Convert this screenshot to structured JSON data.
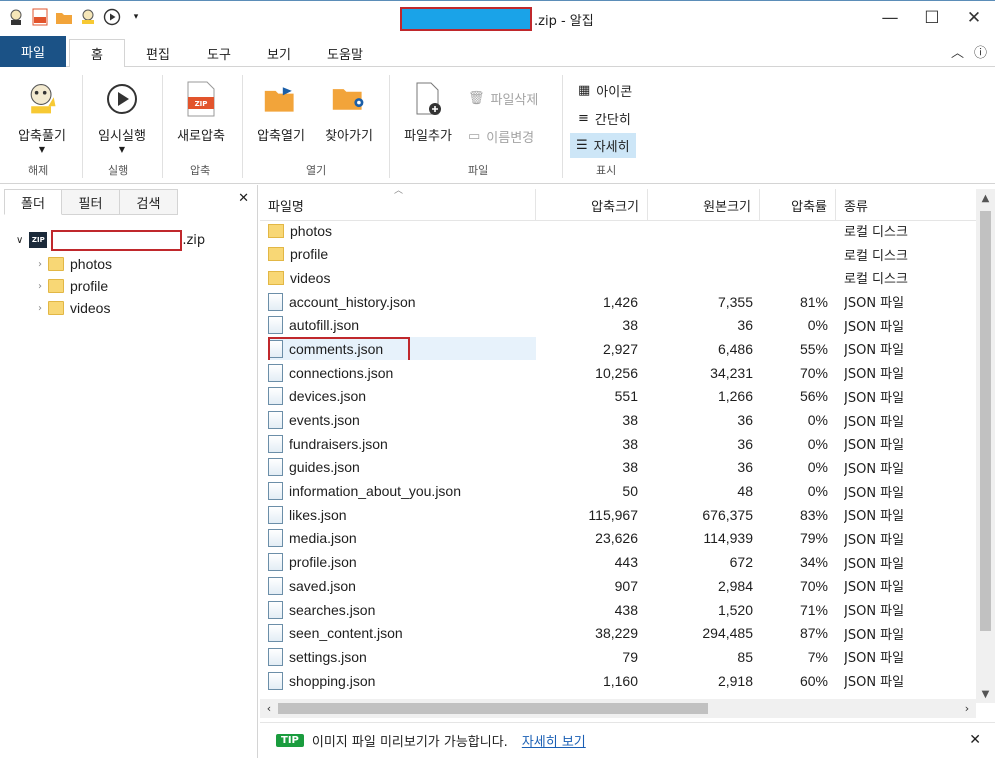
{
  "window": {
    "title_suffix": ".zip - 알집",
    "controls": {
      "minimize": "—",
      "maximize": "☐",
      "close": "✕"
    }
  },
  "tabs": [
    "파일",
    "홈",
    "편집",
    "도구",
    "보기",
    "도움말"
  ],
  "ribbon": {
    "extract": {
      "label": "압축풀기",
      "group": "해제"
    },
    "run": {
      "label": "임시실행",
      "group": "실행"
    },
    "new_zip": {
      "label": "새로압축",
      "group": "압축"
    },
    "open_zip": {
      "label": "압축열기"
    },
    "find": {
      "label": "찾아가기"
    },
    "open_group": "열기",
    "add_file": {
      "label": "파일추가"
    },
    "delete_file": {
      "label": "파일삭제"
    },
    "rename": {
      "label": "이름변경"
    },
    "file_group": "파일",
    "view_icons": "아이콘",
    "view_simple": "간단히",
    "view_detail": "자세히",
    "view_group": "표시"
  },
  "left_pane": {
    "tabs": [
      "폴더",
      "필터",
      "검색"
    ],
    "root_suffix": ".zip",
    "folders": [
      "photos",
      "profile",
      "videos"
    ]
  },
  "columns": [
    "파일명",
    "압축크기",
    "원본크기",
    "압축률",
    "종류"
  ],
  "files": [
    {
      "name": "photos",
      "c": "",
      "o": "",
      "r": "",
      "t": "로컬 디스크",
      "folder": true
    },
    {
      "name": "profile",
      "c": "",
      "o": "",
      "r": "",
      "t": "로컬 디스크",
      "folder": true
    },
    {
      "name": "videos",
      "c": "",
      "o": "",
      "r": "",
      "t": "로컬 디스크",
      "folder": true
    },
    {
      "name": "account_history.json",
      "c": "1,426",
      "o": "7,355",
      "r": "81%",
      "t": "JSON 파일"
    },
    {
      "name": "autofill.json",
      "c": "38",
      "o": "36",
      "r": "0%",
      "t": "JSON 파일"
    },
    {
      "name": "comments.json",
      "c": "2,927",
      "o": "6,486",
      "r": "55%",
      "t": "JSON 파일",
      "selected": true
    },
    {
      "name": "connections.json",
      "c": "10,256",
      "o": "34,231",
      "r": "70%",
      "t": "JSON 파일"
    },
    {
      "name": "devices.json",
      "c": "551",
      "o": "1,266",
      "r": "56%",
      "t": "JSON 파일"
    },
    {
      "name": "events.json",
      "c": "38",
      "o": "36",
      "r": "0%",
      "t": "JSON 파일"
    },
    {
      "name": "fundraisers.json",
      "c": "38",
      "o": "36",
      "r": "0%",
      "t": "JSON 파일"
    },
    {
      "name": "guides.json",
      "c": "38",
      "o": "36",
      "r": "0%",
      "t": "JSON 파일"
    },
    {
      "name": "information_about_you.json",
      "c": "50",
      "o": "48",
      "r": "0%",
      "t": "JSON 파일"
    },
    {
      "name": "likes.json",
      "c": "115,967",
      "o": "676,375",
      "r": "83%",
      "t": "JSON 파일"
    },
    {
      "name": "media.json",
      "c": "23,626",
      "o": "114,939",
      "r": "79%",
      "t": "JSON 파일"
    },
    {
      "name": "profile.json",
      "c": "443",
      "o": "672",
      "r": "34%",
      "t": "JSON 파일"
    },
    {
      "name": "saved.json",
      "c": "907",
      "o": "2,984",
      "r": "70%",
      "t": "JSON 파일"
    },
    {
      "name": "searches.json",
      "c": "438",
      "o": "1,520",
      "r": "71%",
      "t": "JSON 파일"
    },
    {
      "name": "seen_content.json",
      "c": "38,229",
      "o": "294,485",
      "r": "87%",
      "t": "JSON 파일"
    },
    {
      "name": "settings.json",
      "c": "79",
      "o": "85",
      "r": "7%",
      "t": "JSON 파일"
    },
    {
      "name": "shopping.json",
      "c": "1,160",
      "o": "2,918",
      "r": "60%",
      "t": "JSON 파일"
    }
  ],
  "tip": {
    "badge": "TIP",
    "text": "이미지 파일 미리보기가 가능합니다.",
    "link": "자세히 보기"
  }
}
